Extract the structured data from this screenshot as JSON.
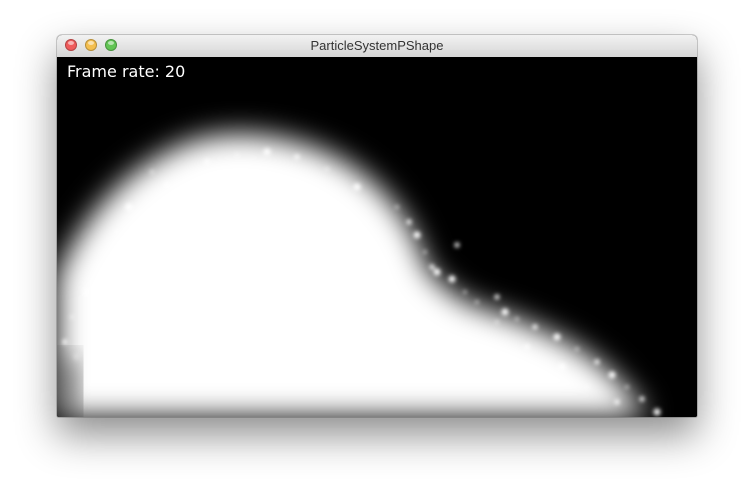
{
  "window": {
    "title": "ParticleSystemPShape",
    "controls": {
      "close_color": "#ef5b5b",
      "minimize_color": "#f4bf4f",
      "zoom_color": "#62c554"
    }
  },
  "canvas": {
    "background": "#000000",
    "particle_color": "#ffffff",
    "frame_rate_label": "Frame rate: 20"
  }
}
